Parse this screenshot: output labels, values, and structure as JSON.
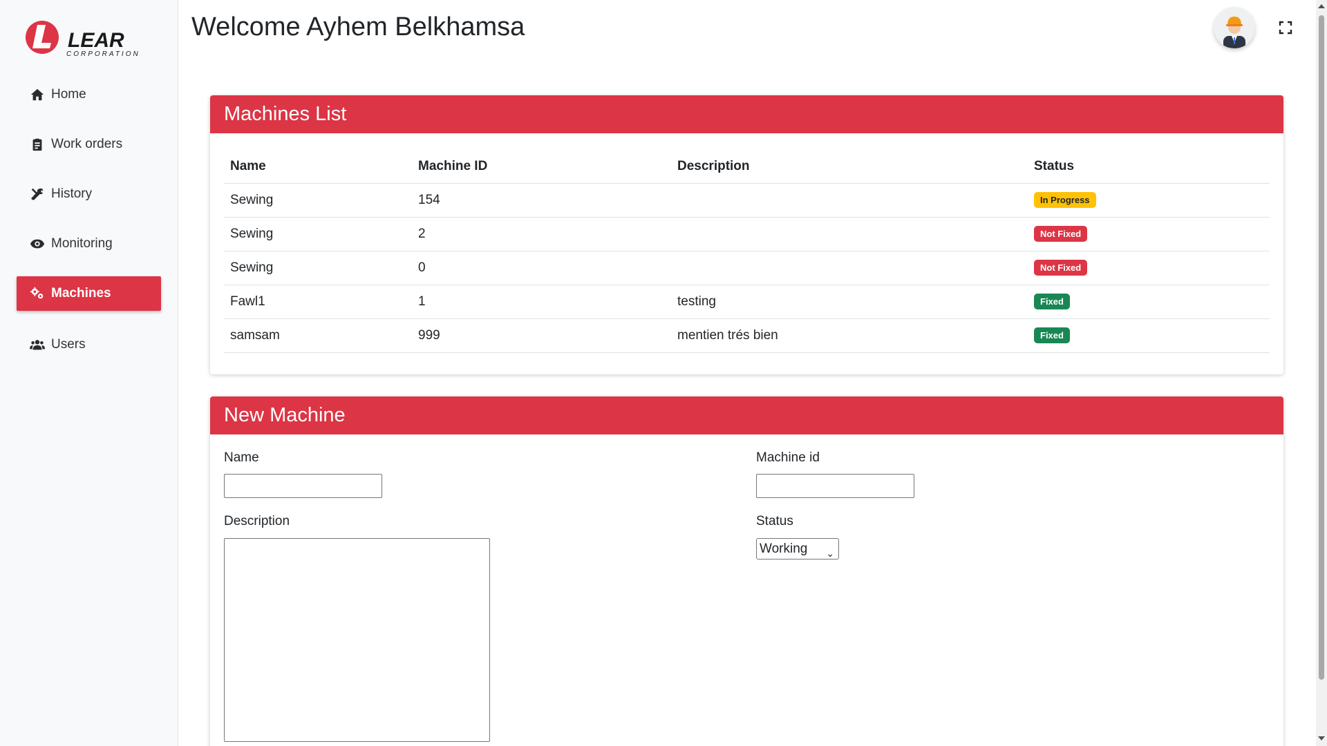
{
  "brand": {
    "logo_text": "LEAR",
    "logo_subtext": "CORPORATION",
    "logo_letter": "L",
    "accent": "#dc3545"
  },
  "sidebar": {
    "items": [
      {
        "label": "Home",
        "icon": "home-icon"
      },
      {
        "label": "Work orders",
        "icon": "clipboard-icon"
      },
      {
        "label": "History",
        "icon": "tools-icon"
      },
      {
        "label": "Monitoring",
        "icon": "eye-icon"
      },
      {
        "label": "Machines",
        "icon": "gears-icon",
        "active": true
      },
      {
        "label": "Users",
        "icon": "users-icon"
      }
    ]
  },
  "header": {
    "welcome": "Welcome Ayhem Belkhamsa",
    "avatar": "avatar",
    "fullscreen": "fullscreen-icon"
  },
  "machines_list": {
    "title": "Machines List",
    "columns": [
      "Name",
      "Machine ID",
      "Description",
      "Status"
    ],
    "rows": [
      {
        "name": "Sewing",
        "id": "154",
        "description": "",
        "status": "In Progress",
        "status_color": "#ffc107",
        "status_text_color": "#212529"
      },
      {
        "name": "Sewing",
        "id": "2",
        "description": "",
        "status": "Not Fixed",
        "status_color": "#dc3545",
        "status_text_color": "#ffffff"
      },
      {
        "name": "Sewing",
        "id": "0",
        "description": "",
        "status": "Not Fixed",
        "status_color": "#dc3545",
        "status_text_color": "#ffffff"
      },
      {
        "name": "Fawl1",
        "id": "1",
        "description": "testing",
        "status": "Fixed",
        "status_color": "#198754",
        "status_text_color": "#ffffff"
      },
      {
        "name": "samsam",
        "id": "999",
        "description": "mentien trés bien",
        "status": "Fixed",
        "status_color": "#198754",
        "status_text_color": "#ffffff"
      }
    ]
  },
  "new_machine": {
    "title": "New Machine",
    "name_label": "Name",
    "name_value": "",
    "machine_id_label": "Machine id",
    "machine_id_value": "",
    "description_label": "Description",
    "description_value": "",
    "status_label": "Status",
    "status_selected": "Working"
  }
}
